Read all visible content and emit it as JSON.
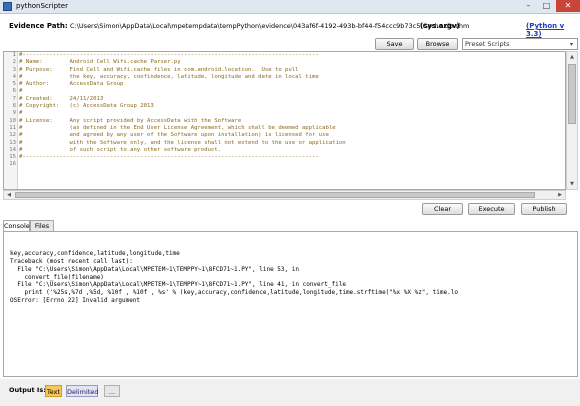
{
  "window": {
    "title": "pythonScripter",
    "minimize": "–",
    "maximize": "□",
    "close": "✕"
  },
  "path_row": {
    "label": "Evidence Path:",
    "value": "C:\\Users\\Simon\\AppData\\Local\\mpetempdata\\tempPython\\evidence\\043af6f-4192-493b-bf44-f54ccc9b73c5\\Cache.db-shm",
    "sysargv": "(sys.argv)",
    "python_link": "(Python v 3.3)"
  },
  "toolbar": {
    "save": "Save",
    "browse": "Browse",
    "preset_placeholder": "Preset Scripts",
    "preset_dropdown": "▾"
  },
  "editor": {
    "line_numbers": [
      "1",
      "2",
      "3",
      "4",
      "5",
      "6",
      "7",
      "8",
      "9",
      "10",
      "11",
      "12",
      "13",
      "14",
      "15",
      "16",
      ""
    ],
    "lines": [
      "#----------------------------------------------------------------------------------------",
      "# Name:        Android Cell Wifi.cache Parser.py",
      "# Purpose:     Find Cell and Wifi.cache files in com.android.location.  Use to pull",
      "#              the key, accuracy, confindence, latitude, longitude and date in local time",
      "# Author:      AccessData Group",
      "#",
      "# Created:     24/11/2013",
      "# Copyright:   (c) AccessData Group 2013",
      "#",
      "# License:     Any script provided by AccessData with the Software",
      "#              (as defined in the End User License Agreement, which shall be deemed applicable",
      "#              and agreed by any user of the Software upon installation) is licensed for use",
      "#              with the Software only, and the license shall not extend to the use or application",
      "#              of such script to any other software product.",
      "#----------------------------------------------------------------------------------------",
      "",
      ""
    ],
    "scroll_up": "▲",
    "scroll_down": "▼",
    "scroll_left": "◀",
    "scroll_right": "▶"
  },
  "actions": {
    "clear": "Clear",
    "execute": "Execute",
    "publish": "Publish"
  },
  "tabs": {
    "console": "Console",
    "files": "Files"
  },
  "console": {
    "lines": [
      "",
      "key,accuracy,confidence,latitude,longitude,time",
      "Traceback (most recent call last):",
      "  File \"C:\\Users\\Simon\\AppData\\Local\\MPETEM~1\\TEMPPY~1\\8FCD71~1.PY\", line 53, in",
      "    convert_file(filename)",
      "  File \"C:\\Users\\Simon\\AppData\\Local\\MPETEM~1\\TEMPPY~1\\8FCD71~1.PY\", line 41, in convert_file",
      "    print ('%25s,%7d ,%5d, %10f , %10f , %s' % (key,accuracy,confidence,latitude,longitude,time.strftime(\"%x %X %z\", time.lo",
      "OSError: [Errno 22] Invalid argument"
    ]
  },
  "output": {
    "label": "Output Is:",
    "text": "Text",
    "delimited": "Delimited",
    "dots": "..."
  }
}
